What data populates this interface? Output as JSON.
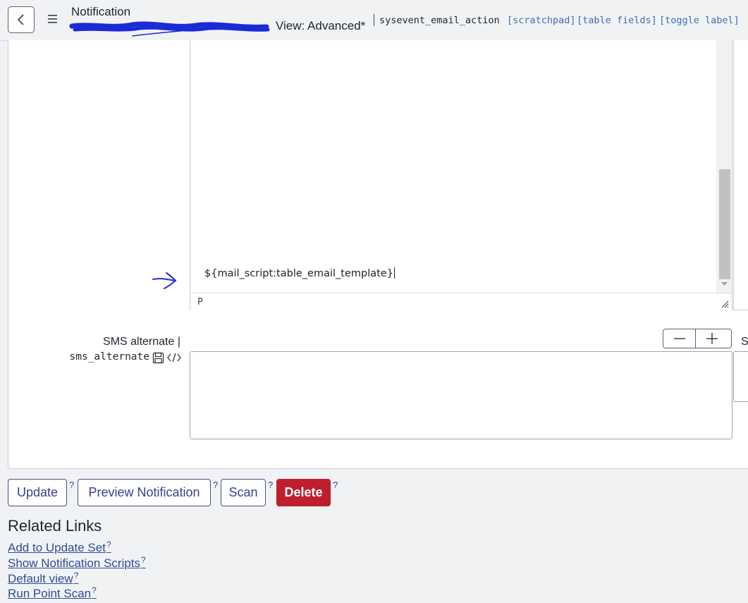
{
  "header": {
    "title": "Notification",
    "view_label": "View: Advanced*",
    "table_name": "sysevent_email_action",
    "links": [
      "[scratchpad]",
      "[table fields]",
      "[toggle label]"
    ]
  },
  "editor": {
    "content_line": "${mail_script:table_email_template}",
    "path_label": "P"
  },
  "sms": {
    "label": "SMS alternate |",
    "field_name": "sms_alternate",
    "value": "",
    "side_letter": "S"
  },
  "buttons": {
    "update": "Update",
    "preview": "Preview Notification",
    "scan": "Scan",
    "delete": "Delete",
    "help": "?"
  },
  "related": {
    "title": "Related Links",
    "links": [
      "Add to Update Set",
      "Show Notification Scripts",
      "Default view",
      "Run Point Scan"
    ],
    "help": "?"
  },
  "colors": {
    "primary": "#3a3f8c",
    "danger": "#be1e2d",
    "link": "#2e4d96",
    "annotation": "#1a2bd6"
  }
}
